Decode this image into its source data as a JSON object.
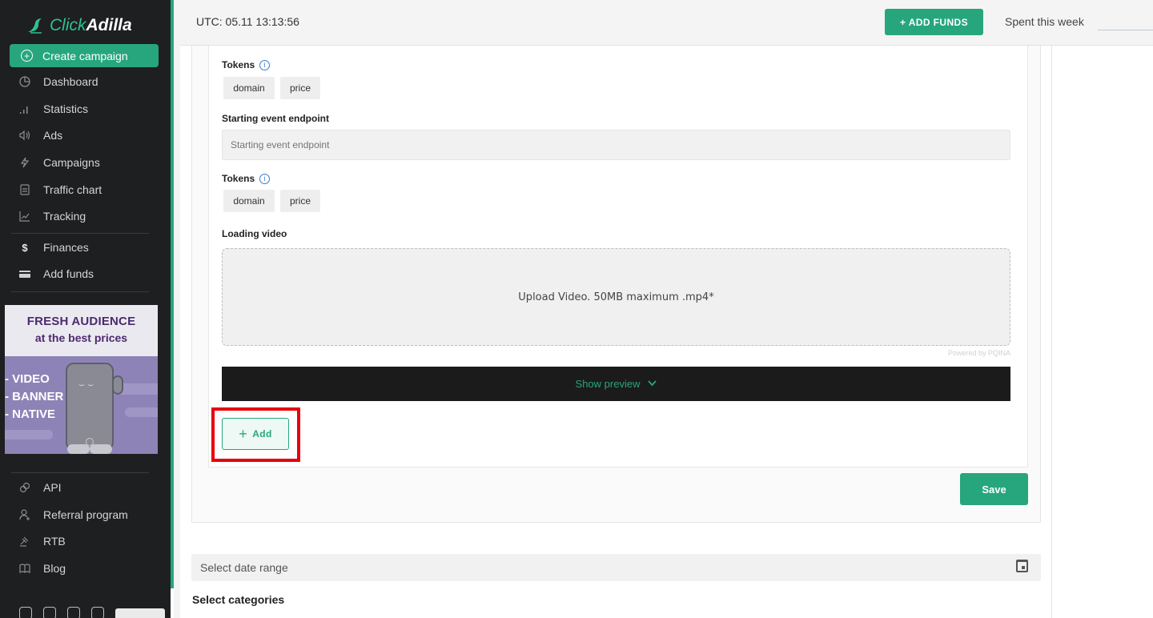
{
  "app": {
    "logo_part1": "Click",
    "logo_part2": "Adilla"
  },
  "sidebar": {
    "create_label": "Create campaign",
    "items": [
      {
        "label": "Dashboard",
        "icon": "pie-chart-icon"
      },
      {
        "label": "Statistics",
        "icon": "bar-chart-icon"
      },
      {
        "label": "Ads",
        "icon": "speaker-icon"
      },
      {
        "label": "Campaigns",
        "icon": "lightning-icon"
      },
      {
        "label": "Traffic chart",
        "icon": "document-icon"
      },
      {
        "label": "Tracking",
        "icon": "line-chart-icon"
      },
      {
        "label": "Finances",
        "icon": "dollar-icon"
      },
      {
        "label": "Add funds",
        "icon": "card-icon"
      },
      {
        "label": "API",
        "icon": "link-icon"
      },
      {
        "label": "Referral program",
        "icon": "user-add-icon"
      },
      {
        "label": "RTB",
        "icon": "gavel-icon"
      },
      {
        "label": "Blog",
        "icon": "book-icon"
      }
    ],
    "promo": {
      "headline": "FRESH AUDIENCE",
      "subline": "at the best prices",
      "formats": [
        "- VIDEO",
        "- BANNER",
        "- NATIVE"
      ]
    }
  },
  "topbar": {
    "utc": "UTC: 05.11 13:13:56",
    "add_funds": "+ ADD FUNDS",
    "spent": "Spent this week"
  },
  "form": {
    "tokens_label": "Tokens",
    "tokens_1": [
      "domain",
      "price"
    ],
    "starting_endpoint_label": "Starting event endpoint",
    "starting_endpoint_placeholder": "Starting event endpoint",
    "tokens_2": [
      "domain",
      "price"
    ],
    "loading_video_label": "Loading video",
    "upload_text": "Upload Video. 50MB maximum .mp4*",
    "powered_by": "Powered by PQINA",
    "show_preview": "Show preview",
    "add_label": "Add",
    "save_label": "Save"
  },
  "filters": {
    "date_range_placeholder": "Select date range",
    "select_categories": "Select categories"
  },
  "colors": {
    "accent": "#27a67e",
    "sidebar_bg": "#1e1f20",
    "highlight": "#e8000b"
  }
}
